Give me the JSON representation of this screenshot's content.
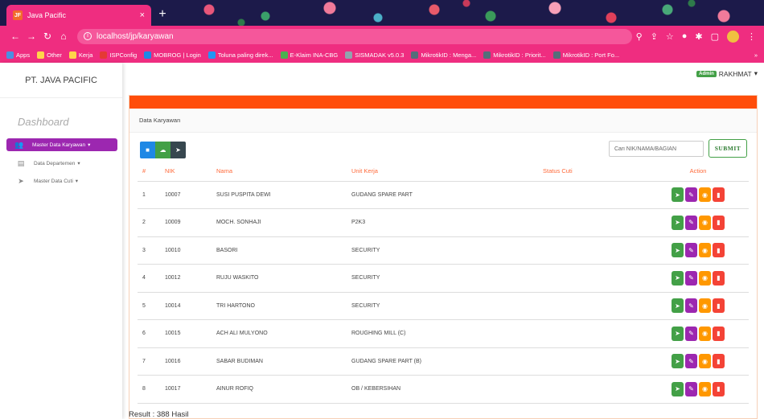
{
  "browser": {
    "tab_title": "Java Pacific",
    "tab_favicon": "JF",
    "url": "localhost/jp/karyawan",
    "bookmarks": [
      {
        "label": "Apps",
        "color": "#4a90e2"
      },
      {
        "label": "Other",
        "color": "#ffd54a"
      },
      {
        "label": "Kerja",
        "color": "#ffd54a"
      },
      {
        "label": "ISPConfig",
        "color": "#e53935"
      },
      {
        "label": "MOBROG | Login",
        "color": "#1e88e5"
      },
      {
        "label": "Toluna paling direk...",
        "color": "#2196f3"
      },
      {
        "label": "E-Klaim INA-CBG",
        "color": "#4caf50"
      },
      {
        "label": "SISMADAK v5.0.3",
        "color": "#90a4ae"
      },
      {
        "label": "MikrotikID : Menga...",
        "color": "#546e7a"
      },
      {
        "label": "MikrotikID : Priorit...",
        "color": "#546e7a"
      },
      {
        "label": "MikrotikID : Port Fo...",
        "color": "#546e7a"
      }
    ]
  },
  "sidebar": {
    "brand": "PT. JAVA PACIFIC",
    "title": "Dashboard",
    "items": [
      {
        "label": "Master Data Karyawan",
        "icon": "users-icon",
        "active": true
      },
      {
        "label": "Data Departemen",
        "icon": "building-icon",
        "active": false
      },
      {
        "label": "Master Data Cuti",
        "icon": "paper-plane-icon",
        "active": false
      }
    ]
  },
  "user": {
    "badge": "Admin",
    "name": "RAKHMAT"
  },
  "card": {
    "subtitle": "Data Karyawan",
    "search_placeholder": "Cari NIK/NAMA/BAGIAN",
    "submit_label": "SUBMIT"
  },
  "table": {
    "headers": [
      "#",
      "NIK",
      "Nama",
      "Unit Kerja",
      "Status Cuti",
      "Action"
    ],
    "rows": [
      {
        "no": "1",
        "nik": "10007",
        "nama": "SUSI PUSPITA DEWI",
        "unit": "GUDANG SPARE PART",
        "status": ""
      },
      {
        "no": "2",
        "nik": "10009",
        "nama": "MOCH. SONHAJI",
        "unit": "P2K3",
        "status": ""
      },
      {
        "no": "3",
        "nik": "10010",
        "nama": "BASORI",
        "unit": "SECURITY",
        "status": ""
      },
      {
        "no": "4",
        "nik": "10012",
        "nama": "RUJU WASKITO",
        "unit": "SECURITY",
        "status": ""
      },
      {
        "no": "5",
        "nik": "10014",
        "nama": "TRI HARTONO",
        "unit": "SECURITY",
        "status": ""
      },
      {
        "no": "6",
        "nik": "10015",
        "nama": "ACH ALI MULYONO",
        "unit": "ROUGHING MILL (C)",
        "status": ""
      },
      {
        "no": "7",
        "nik": "10016",
        "nama": "SABAR BUDIMAN",
        "unit": "GUDANG SPARE PART (B)",
        "status": ""
      },
      {
        "no": "8",
        "nik": "10017",
        "nama": "AINUR ROFIQ",
        "unit": "OB / KEBERSIHAN",
        "status": ""
      }
    ]
  },
  "result": "Result : 388 Hasil",
  "colors": {
    "chrome": "#ef2d80",
    "card_header": "#ff4d0a",
    "active_menu": "#9c27b0",
    "action_send": "#43a047",
    "action_edit": "#9c27b0",
    "action_view": "#ff9800",
    "action_delete": "#f44336"
  }
}
